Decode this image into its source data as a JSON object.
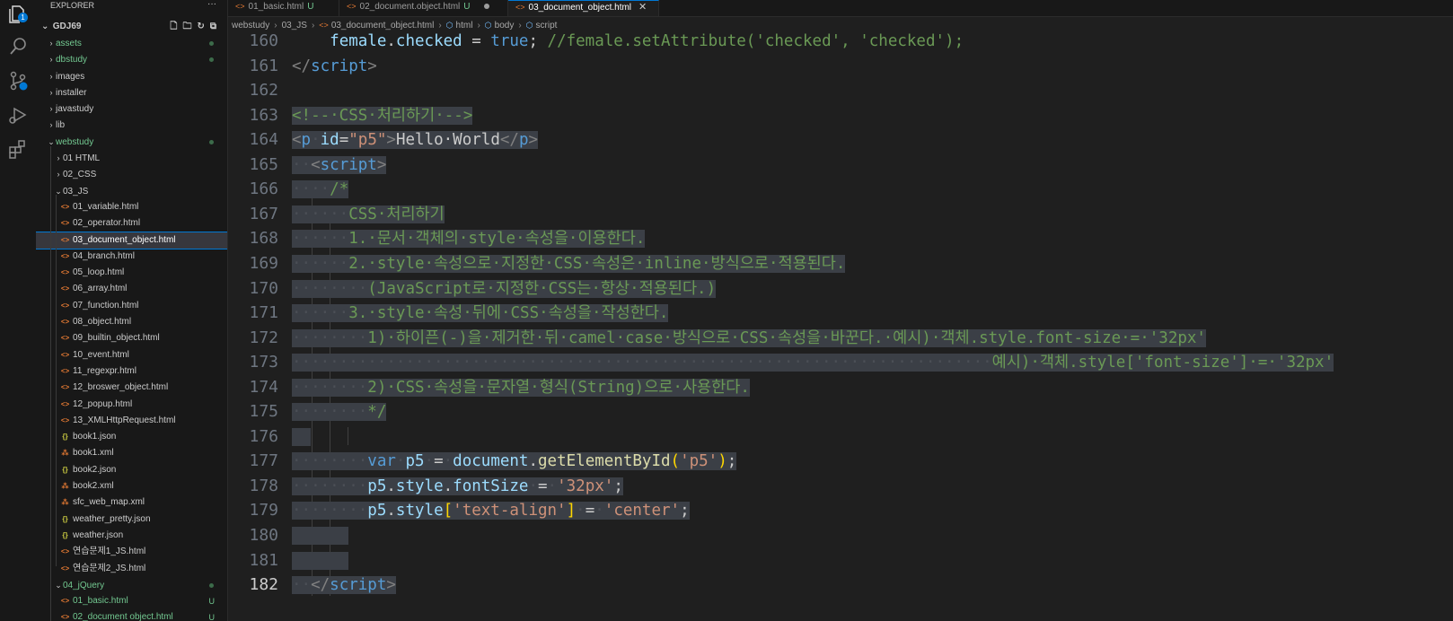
{
  "activity_bar": {
    "explorer_badge": "1",
    "icons": [
      "files-icon",
      "search-icon",
      "source-control-icon",
      "run-debug-icon",
      "extensions-icon"
    ]
  },
  "sidebar": {
    "title": "EXPLORER",
    "more": "···",
    "root": "GDJ69",
    "items": [
      {
        "label": "assets",
        "kind": "folder",
        "depth": 0,
        "open": false,
        "color": "#73c991",
        "dot": true
      },
      {
        "label": "dbstudy",
        "kind": "folder",
        "depth": 0,
        "open": false,
        "color": "#73c991",
        "dot": true
      },
      {
        "label": "images",
        "kind": "folder",
        "depth": 0,
        "open": false
      },
      {
        "label": "installer",
        "kind": "folder",
        "depth": 0,
        "open": false
      },
      {
        "label": "javastudy",
        "kind": "folder",
        "depth": 0,
        "open": false
      },
      {
        "label": "lib",
        "kind": "folder",
        "depth": 0,
        "open": false
      },
      {
        "label": "webstudy",
        "kind": "folder",
        "depth": 0,
        "open": true,
        "color": "#73c991",
        "dot": true
      },
      {
        "label": "01 HTML",
        "kind": "folder",
        "depth": 1,
        "open": false
      },
      {
        "label": "02_CSS",
        "kind": "folder",
        "depth": 1,
        "open": false
      },
      {
        "label": "03_JS",
        "kind": "folder",
        "depth": 1,
        "open": true
      },
      {
        "label": "01_variable.html",
        "kind": "html",
        "depth": 2
      },
      {
        "label": "02_operator.html",
        "kind": "html",
        "depth": 2
      },
      {
        "label": "03_document_object.html",
        "kind": "html",
        "depth": 2,
        "selected": true
      },
      {
        "label": "04_branch.html",
        "kind": "html",
        "depth": 2
      },
      {
        "label": "05_loop.html",
        "kind": "html",
        "depth": 2
      },
      {
        "label": "06_array.html",
        "kind": "html",
        "depth": 2
      },
      {
        "label": "07_function.html",
        "kind": "html",
        "depth": 2
      },
      {
        "label": "08_object.html",
        "kind": "html",
        "depth": 2
      },
      {
        "label": "09_builtin_object.html",
        "kind": "html",
        "depth": 2
      },
      {
        "label": "10_event.html",
        "kind": "html",
        "depth": 2
      },
      {
        "label": "11_regexpr.html",
        "kind": "html",
        "depth": 2
      },
      {
        "label": "12_broswer_object.html",
        "kind": "html",
        "depth": 2
      },
      {
        "label": "12_popup.html",
        "kind": "html",
        "depth": 2
      },
      {
        "label": "13_XMLHttpRequest.html",
        "kind": "html",
        "depth": 2
      },
      {
        "label": "book1.json",
        "kind": "json",
        "depth": 2
      },
      {
        "label": "book1.xml",
        "kind": "xml",
        "depth": 2
      },
      {
        "label": "book2.json",
        "kind": "json",
        "depth": 2
      },
      {
        "label": "book2.xml",
        "kind": "xml",
        "depth": 2
      },
      {
        "label": "sfc_web_map.xml",
        "kind": "xml",
        "depth": 2
      },
      {
        "label": "weather_pretty.json",
        "kind": "json",
        "depth": 2
      },
      {
        "label": "weather.json",
        "kind": "json",
        "depth": 2
      },
      {
        "label": "연습문제1_JS.html",
        "kind": "html",
        "depth": 2
      },
      {
        "label": "연습문제2_JS.html",
        "kind": "html",
        "depth": 2
      },
      {
        "label": "04_jQuery",
        "kind": "folder",
        "depth": 1,
        "open": true,
        "color": "#73c991",
        "dot": true
      },
      {
        "label": "01_basic.html",
        "kind": "html",
        "depth": 2,
        "color": "#73c991",
        "status": "U"
      },
      {
        "label": "02_document object.html",
        "kind": "html",
        "depth": 2,
        "color": "#73c991",
        "status": "U"
      }
    ]
  },
  "tabs": [
    {
      "label": "01_basic.html",
      "status": "U",
      "active": false
    },
    {
      "label": "02_document.object.html",
      "status": "U",
      "dirty": true,
      "active": false
    },
    {
      "label": "03_document_object.html",
      "active": true,
      "close": "✕"
    }
  ],
  "breadcrumb": {
    "parts": [
      "webstudy",
      "03_JS",
      "03_document_object.html",
      "html",
      "body",
      "script"
    ]
  },
  "editor": {
    "current_line": 182,
    "lines": [
      {
        "n": "160",
        "sel": false,
        "segs": [
          [
            "pl",
            "    "
          ],
          [
            "vr",
            "female"
          ],
          [
            "pl",
            "."
          ],
          [
            "vr",
            "checked"
          ],
          [
            "pl",
            " = "
          ],
          [
            "kw",
            "true"
          ],
          [
            "pl",
            "; "
          ],
          [
            "cm",
            "//female.setAttribute('checked', 'checked');"
          ]
        ]
      },
      {
        "n": "161",
        "sel": false,
        "segs": [
          [
            "tgb",
            "</"
          ],
          [
            "tg",
            "script"
          ],
          [
            "tgb",
            ">"
          ]
        ]
      },
      {
        "n": "162",
        "sel": false,
        "segs": []
      },
      {
        "n": "163",
        "sel": true,
        "segs": [
          [
            "cm",
            "<!--·CSS·처리하기·-->"
          ]
        ]
      },
      {
        "n": "164",
        "sel": true,
        "segs": [
          [
            "tgb",
            "<"
          ],
          [
            "tg",
            "p"
          ],
          [
            "ws",
            "·"
          ],
          [
            "at",
            "id"
          ],
          [
            "pl",
            "="
          ],
          [
            "st",
            "\"p5\""
          ],
          [
            "tgb",
            ">"
          ],
          [
            "pl",
            "Hello·World"
          ],
          [
            "tgb",
            "</"
          ],
          [
            "tg",
            "p"
          ],
          [
            "tgb",
            ">"
          ]
        ]
      },
      {
        "n": "165",
        "sel": true,
        "segs": [
          [
            "ws",
            "··"
          ],
          [
            "tgb",
            "<"
          ],
          [
            "tg",
            "script"
          ],
          [
            "tgb",
            ">"
          ]
        ]
      },
      {
        "n": "166",
        "sel": true,
        "segs": [
          [
            "ws",
            "····"
          ],
          [
            "cm",
            "/*"
          ]
        ]
      },
      {
        "n": "167",
        "sel": true,
        "segs": [
          [
            "ws",
            "······"
          ],
          [
            "cm",
            "CSS·처리하기"
          ]
        ]
      },
      {
        "n": "168",
        "sel": true,
        "segs": [
          [
            "ws",
            "······"
          ],
          [
            "cm",
            "1.·문서·객체의·style·속성을·이용한다."
          ]
        ]
      },
      {
        "n": "169",
        "sel": true,
        "segs": [
          [
            "ws",
            "······"
          ],
          [
            "cm",
            "2.·style·속성으로·지정한·CSS·속성은·inline·방식으로·적용된다."
          ]
        ]
      },
      {
        "n": "170",
        "sel": true,
        "segs": [
          [
            "ws",
            "········"
          ],
          [
            "cm",
            "(JavaScript로·지정한·CSS는·항상·적용된다.)"
          ]
        ]
      },
      {
        "n": "171",
        "sel": true,
        "segs": [
          [
            "ws",
            "······"
          ],
          [
            "cm",
            "3.·style·속성·뒤에·CSS·속성을·작성한다."
          ]
        ]
      },
      {
        "n": "172",
        "sel": true,
        "segs": [
          [
            "ws",
            "········"
          ],
          [
            "cm",
            "1)·하이픈(-)을·제거한·뒤·camel·case·방식으로·CSS·속성을·바꾼다.·예시)·객체.style.font-size·=·'32px'"
          ]
        ]
      },
      {
        "n": "173",
        "sel": true,
        "segs": [
          [
            "ws",
            "··········································································"
          ],
          [
            "cm",
            "예시)·객체.style['font-size']·=·'32px'"
          ]
        ]
      },
      {
        "n": "174",
        "sel": true,
        "segs": [
          [
            "ws",
            "········"
          ],
          [
            "cm",
            "2)·CSS·속성을·문자열·형식(String)으로·사용한다."
          ]
        ]
      },
      {
        "n": "175",
        "sel": true,
        "segs": [
          [
            "ws",
            "········"
          ],
          [
            "cm",
            "*/"
          ]
        ]
      },
      {
        "n": "176",
        "sel": true,
        "segs": [
          [
            "ws",
            "  "
          ]
        ]
      },
      {
        "n": "177",
        "sel": true,
        "segs": [
          [
            "ws",
            "········"
          ],
          [
            "kw",
            "var"
          ],
          [
            "ws",
            "·"
          ],
          [
            "vr",
            "p5"
          ],
          [
            "ws",
            "·"
          ],
          [
            "pl",
            "="
          ],
          [
            "ws",
            "·"
          ],
          [
            "vr",
            "document"
          ],
          [
            "pl",
            "."
          ],
          [
            "fn",
            "getElementById"
          ],
          [
            "br",
            "("
          ],
          [
            "st",
            "'p5'"
          ],
          [
            "br",
            ")"
          ],
          [
            "pl",
            ";"
          ]
        ]
      },
      {
        "n": "178",
        "sel": true,
        "segs": [
          [
            "ws",
            "········"
          ],
          [
            "vr",
            "p5"
          ],
          [
            "pl",
            "."
          ],
          [
            "vr",
            "style"
          ],
          [
            "pl",
            "."
          ],
          [
            "vr",
            "fontSize"
          ],
          [
            "ws",
            "·"
          ],
          [
            "pl",
            "="
          ],
          [
            "ws",
            "·"
          ],
          [
            "st",
            "'32px'"
          ],
          [
            "pl",
            ";"
          ]
        ]
      },
      {
        "n": "179",
        "sel": true,
        "segs": [
          [
            "ws",
            "········"
          ],
          [
            "vr",
            "p5"
          ],
          [
            "pl",
            "."
          ],
          [
            "vr",
            "style"
          ],
          [
            "br",
            "["
          ],
          [
            "st",
            "'text-align'"
          ],
          [
            "br",
            "]"
          ],
          [
            "ws",
            "·"
          ],
          [
            "pl",
            "="
          ],
          [
            "ws",
            "·"
          ],
          [
            "st",
            "'center'"
          ],
          [
            "pl",
            ";"
          ]
        ]
      },
      {
        "n": "180",
        "sel": true,
        "segs": [
          [
            "ws",
            "      "
          ]
        ]
      },
      {
        "n": "181",
        "sel": true,
        "segs": [
          [
            "ws",
            "      "
          ]
        ]
      },
      {
        "n": "182",
        "sel": true,
        "segs": [
          [
            "ws",
            "··"
          ],
          [
            "tgb",
            "</"
          ],
          [
            "tg",
            "script"
          ],
          [
            "tgb",
            ">"
          ]
        ]
      }
    ]
  }
}
